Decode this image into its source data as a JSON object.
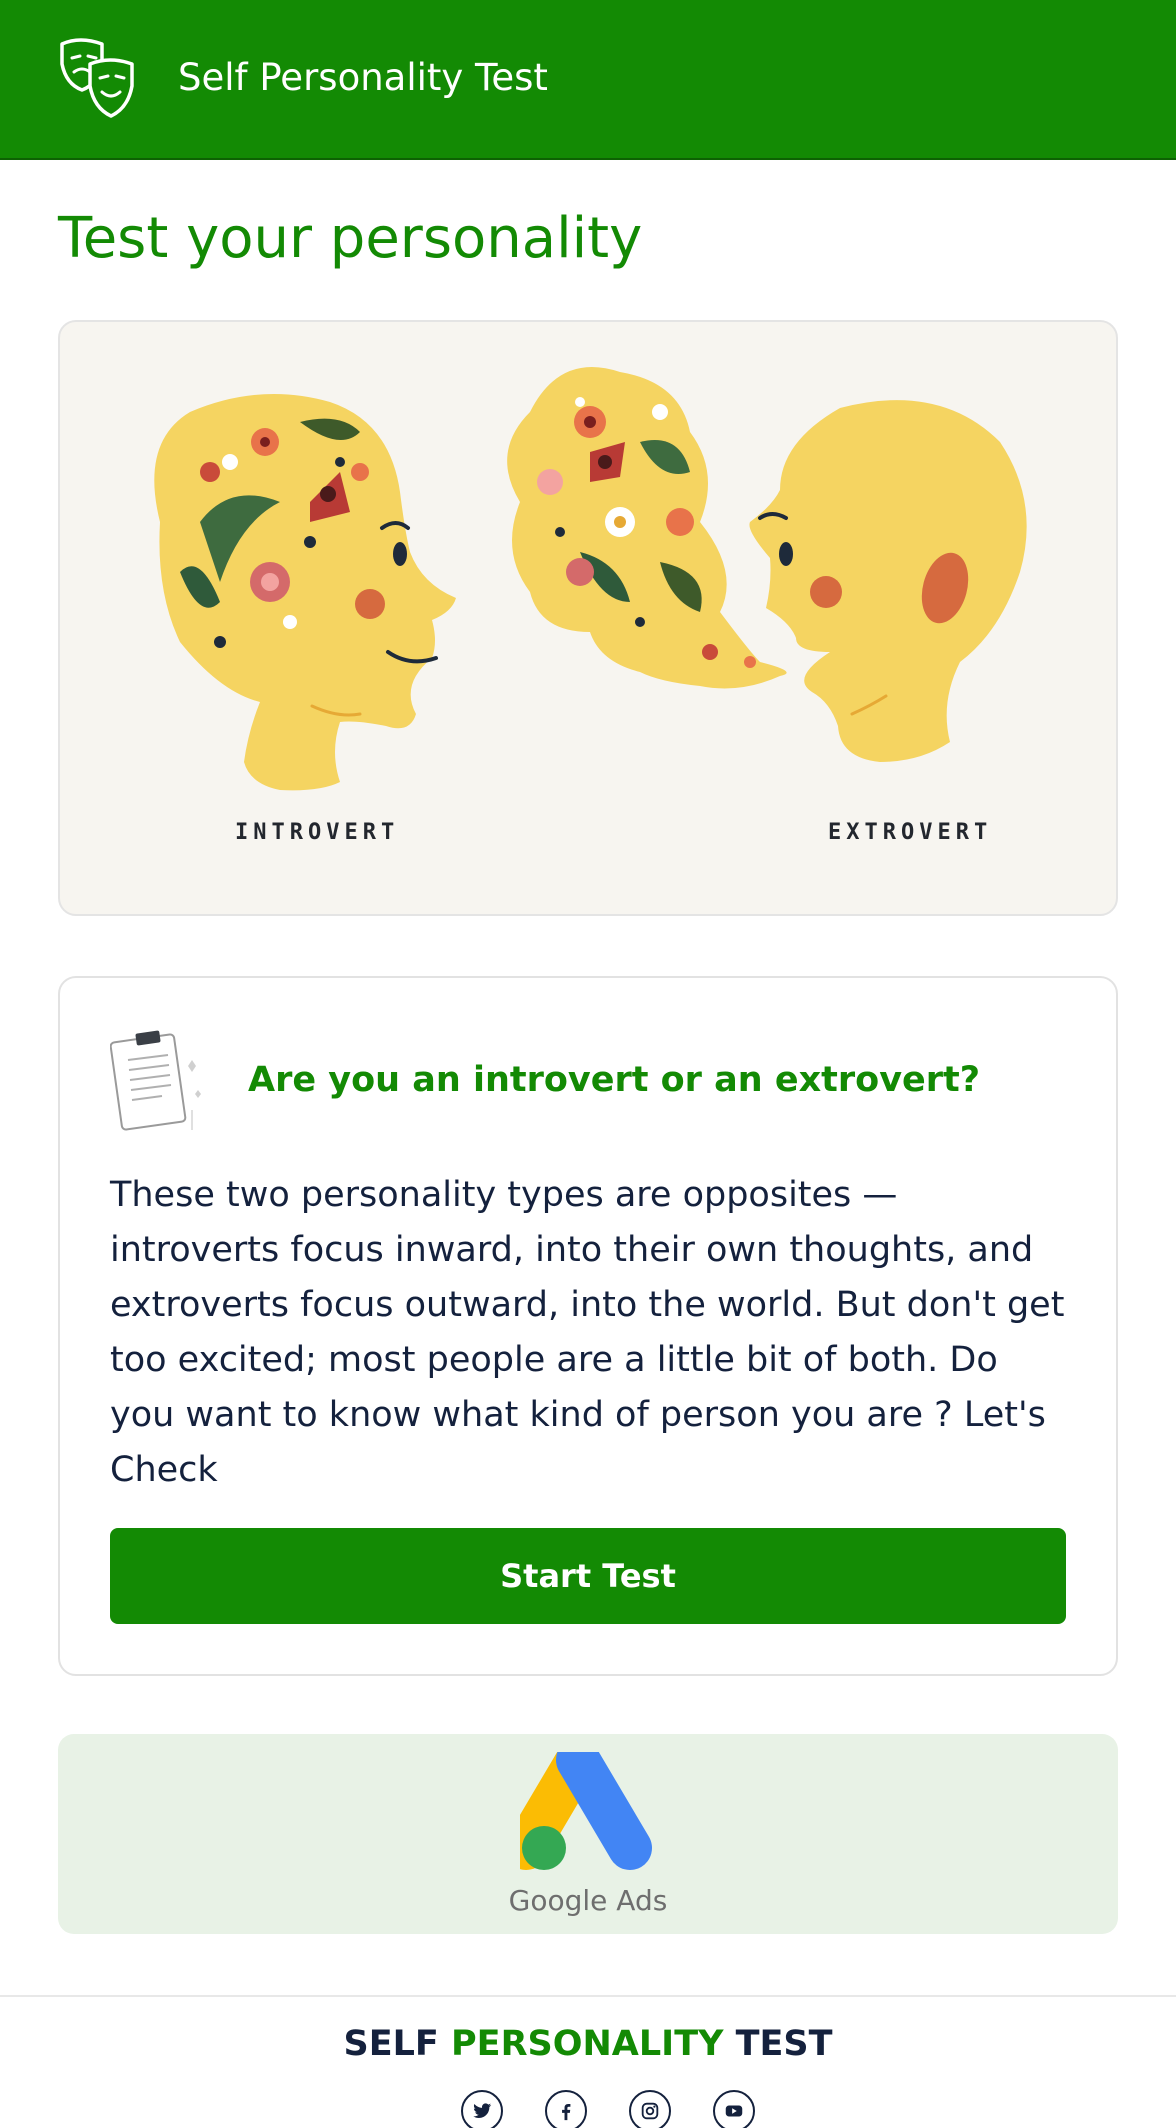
{
  "header": {
    "app_title": "Self Personality Test",
    "logo_icon": "theater-masks-icon"
  },
  "page": {
    "title": "Test your personality"
  },
  "hero": {
    "label_left": "INTROVERT",
    "label_right": "EXTROVERT"
  },
  "info_card": {
    "icon": "clipboard-icon",
    "title": "Are you an introvert or an extrovert?",
    "body": "These two personality types are opposites — introverts focus inward, into their own thoughts, and extroverts focus outward, into the world. But don't get too excited; most people are a little bit of both. Do you want to know what kind of person you are ? Let's Check",
    "button_label": "Start Test"
  },
  "ad": {
    "label": "Google Ads"
  },
  "footer": {
    "brand_part1": "SELF ",
    "brand_accent": "PERSONALITY",
    "brand_part2": " TEST",
    "social": [
      "twitter-icon",
      "facebook-icon",
      "instagram-icon",
      "youtube-icon"
    ]
  },
  "colors": {
    "brand_green": "#138a04",
    "text_dark": "#14213d",
    "hero_bg": "#f7f5f0",
    "ad_bg": "#e8f2e6"
  }
}
